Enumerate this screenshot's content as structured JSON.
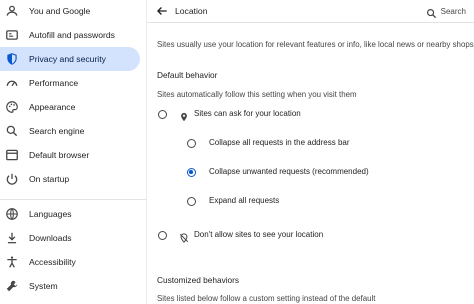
{
  "sidebar": {
    "items": [
      {
        "label": "You and Google",
        "icon": "person-icon"
      },
      {
        "label": "Autofill and passwords",
        "icon": "autofill-icon"
      },
      {
        "label": "Privacy and security",
        "icon": "shield-icon"
      },
      {
        "label": "Performance",
        "icon": "speedometer-icon"
      },
      {
        "label": "Appearance",
        "icon": "palette-icon"
      },
      {
        "label": "Search engine",
        "icon": "search-icon"
      },
      {
        "label": "Default browser",
        "icon": "browser-icon"
      },
      {
        "label": "On startup",
        "icon": "power-icon"
      },
      {
        "label": "Languages",
        "icon": "globe-icon"
      },
      {
        "label": "Downloads",
        "icon": "download-icon"
      },
      {
        "label": "Accessibility",
        "icon": "accessibility-icon"
      },
      {
        "label": "System",
        "icon": "wrench-icon"
      }
    ],
    "active_index": 2,
    "active_color": "#d3e3fd"
  },
  "header": {
    "title": "Location",
    "search_label": "Search"
  },
  "main": {
    "intro": "Sites usually use your location for relevant features or info, like local news or nearby shops",
    "default_heading": "Default behavior",
    "default_desc": "Sites automatically follow this setting when you visit them",
    "option_allow": "Sites can ask for your location",
    "sub_options": [
      {
        "label": "Collapse all requests in the address bar",
        "checked": false
      },
      {
        "label": "Collapse unwanted requests (recommended)",
        "checked": true
      },
      {
        "label": "Expand all requests",
        "checked": false
      }
    ],
    "option_block": "Don't allow sites to see your location",
    "custom_heading": "Customized behaviors",
    "custom_desc": "Sites listed below follow a custom setting instead of the default"
  },
  "colors": {
    "accent": "#0b57d0"
  }
}
